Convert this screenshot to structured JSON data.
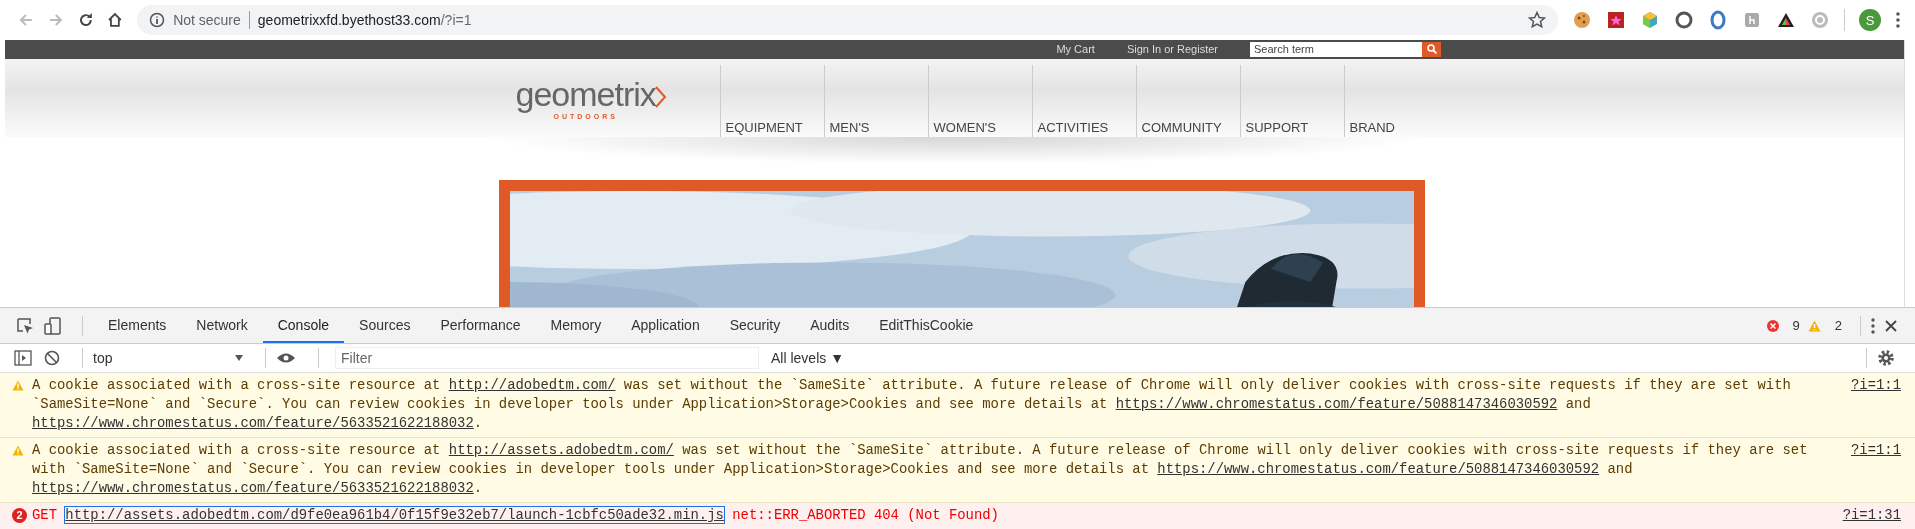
{
  "browser": {
    "security": "Not secure",
    "url_host": "geometrixxfd.byethost33.com",
    "url_path": "/?i=1",
    "account": "S"
  },
  "site": {
    "top_links": [
      "My Cart",
      "Sign In or Register"
    ],
    "search": {
      "placeholder": "Search term"
    },
    "logo": {
      "name": "geometrix",
      "tagline": "OUTDOORS"
    },
    "nav": [
      "EQUIPMENT",
      "MEN'S",
      "WOMEN'S",
      "ACTIVITIES",
      "COMMUNITY",
      "SUPPORT",
      "BRAND"
    ],
    "hero": {
      "kind": "picture"
    }
  },
  "devtools": {
    "tabs": [
      {
        "label": "Elements",
        "selected": false
      },
      {
        "label": "Network",
        "selected": false
      },
      {
        "label": "Console",
        "selected": true
      },
      {
        "label": "Sources",
        "selected": false
      },
      {
        "label": "Performance",
        "selected": false
      },
      {
        "label": "Memory",
        "selected": false
      },
      {
        "label": "Application",
        "selected": false
      },
      {
        "label": "Security",
        "selected": false
      },
      {
        "label": "Audits",
        "selected": false
      },
      {
        "label": "EditThisCookie",
        "selected": false
      }
    ],
    "errors": "9",
    "warnings": "2",
    "context": "top",
    "filter": {
      "placeholder": "Filter"
    },
    "levels": "All levels ▼",
    "messages": [
      {
        "kind": "warning",
        "source": "?i=1:1",
        "parts": [
          {
            "text": "A cookie associated with a cross-site resource at ",
            "link": false
          },
          {
            "text": "http://adobedtm.com/",
            "link": true
          },
          {
            "text": " was set without the `SameSite` attribute. A future release of Chrome will only deliver cookies with cross-site requests if they are set with `SameSite=None` and `Secure`. You can review cookies in developer tools under Application>Storage>Cookies and see more details at ",
            "link": false
          },
          {
            "text": "https://www.chromestatus.com/feature/5088147346030592",
            "link": true
          },
          {
            "text": " and ",
            "link": false
          },
          {
            "text": "https://www.chromestatus.com/feature/5633521622188032",
            "link": true
          },
          {
            "text": ".",
            "link": false
          }
        ]
      },
      {
        "kind": "warning",
        "source": "?i=1:1",
        "parts": [
          {
            "text": "A cookie associated with a cross-site resource at ",
            "link": false
          },
          {
            "text": "http://assets.adobedtm.com/",
            "link": true
          },
          {
            "text": " was set without the `SameSite` attribute. A future release of Chrome will only deliver cookies with cross-site requests if they are set with `SameSite=None` and `Secure`. You can review cookies in developer tools under Application>Storage>Cookies and see more details at ",
            "link": false
          },
          {
            "text": "https://www.chromestatus.com/feature/5088147346030592",
            "link": true
          },
          {
            "text": " and ",
            "link": false
          },
          {
            "text": "https://www.chromestatus.com/feature/5633521622188032",
            "link": true
          },
          {
            "text": ".",
            "link": false
          }
        ]
      },
      {
        "kind": "error",
        "count": "2",
        "source": "?i=1:31",
        "parts": [
          {
            "text": "GET ",
            "link": false
          },
          {
            "text": "http://assets.adobedtm.com/d9fe0ea961b4/0f15f9e32eb7/launch-1cbfc50ade32.min.js",
            "link": true,
            "boxed": true
          },
          {
            "text": " net::ERR_ABORTED 404 (Not Found)",
            "link": false
          }
        ]
      }
    ]
  }
}
